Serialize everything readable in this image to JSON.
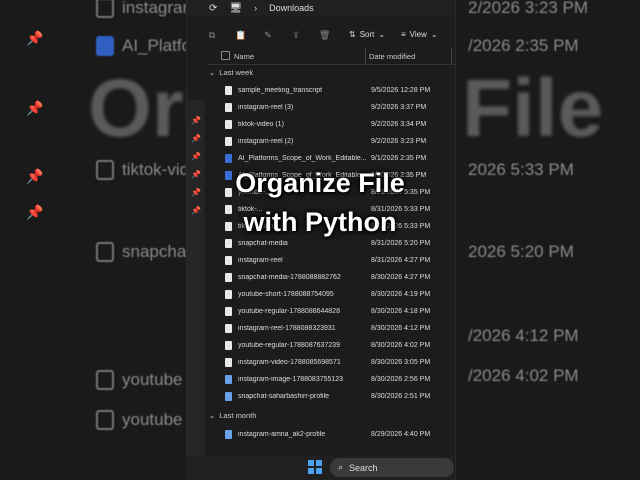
{
  "background": {
    "big_text_1": "Orga",
    "big_text_2": "File",
    "rows_left": [
      "instagram",
      "AI_Platform",
      "tiktok-vide",
      "snapchat-m",
      "youtube",
      "youtube"
    ],
    "dates_right": [
      "2/2026 3:23 PM",
      "/2026 2:35 PM",
      "2026 5:33 PM",
      "2026 5:20 PM",
      "/2026 4:12 PM",
      "/2026 4:02 PM"
    ]
  },
  "address_bar": {
    "breadcrumb": "Downloads"
  },
  "toolbar": {
    "sort_label": "Sort",
    "view_label": "View"
  },
  "columns": {
    "name": "Name",
    "date_modified": "Date modified"
  },
  "groups": {
    "last_week": "Last week",
    "last_month": "Last month"
  },
  "files": [
    {
      "name": "sample_meeting_transcript",
      "date": "9/5/2026 12:28 PM",
      "type": "text"
    },
    {
      "name": "instagram-reel (3)",
      "date": "9/2/2026 3:37 PM",
      "type": "video"
    },
    {
      "name": "tiktok-video (1)",
      "date": "9/2/2026 3:34 PM",
      "type": "video"
    },
    {
      "name": "instagram-reel (2)",
      "date": "9/2/2026 3:23 PM",
      "type": "video"
    },
    {
      "name": "AI_Platforms_Scope_of_Work_Editable...",
      "date": "9/1/2026 2:35 PM",
      "type": "doc"
    },
    {
      "name": "AI_Platforms_Scope_of_Work_Editable",
      "date": "9/1/2026 2:35 PM",
      "type": "doc"
    },
    {
      "name": "youtube-...",
      "date": "8/31/2026 5:35 PM",
      "type": "video"
    },
    {
      "name": "tiktok-...",
      "date": "8/31/2026 5:33 PM",
      "type": "video"
    },
    {
      "name": "tiktok-video",
      "date": "8/31/2026 5:33 PM",
      "type": "video"
    },
    {
      "name": "snapchat-media",
      "date": "8/31/2026 5:20 PM",
      "type": "video"
    },
    {
      "name": "instagram-reel",
      "date": "8/31/2026 4:27 PM",
      "type": "video"
    },
    {
      "name": "snapchat-media-1788088882762",
      "date": "8/30/2026 4:27 PM",
      "type": "video"
    },
    {
      "name": "youtube-short-1788088754095",
      "date": "8/30/2026 4:19 PM",
      "type": "video"
    },
    {
      "name": "youtube-regular-1788088644828",
      "date": "8/30/2026 4:18 PM",
      "type": "video"
    },
    {
      "name": "instagram-reel-1788088323931",
      "date": "8/30/2026 4:12 PM",
      "type": "video"
    },
    {
      "name": "youtube-regular-1788087637239",
      "date": "8/30/2026 4:02 PM",
      "type": "video"
    },
    {
      "name": "instagram-video-1788085698571",
      "date": "8/30/2026 3:05 PM",
      "type": "video"
    },
    {
      "name": "instagram-image-1788083755123",
      "date": "8/30/2026 2:56 PM",
      "type": "image"
    },
    {
      "name": "snapchat-saharbashirr-profile",
      "date": "8/30/2026 2:51 PM",
      "type": "image"
    },
    {
      "name": "instagram-amna_ak2-profile",
      "date": "8/29/2026 4:40 PM",
      "type": "image"
    }
  ],
  "overlay": {
    "line1": "Organize File",
    "line2": "with Python"
  },
  "taskbar": {
    "search_label": "Search"
  }
}
